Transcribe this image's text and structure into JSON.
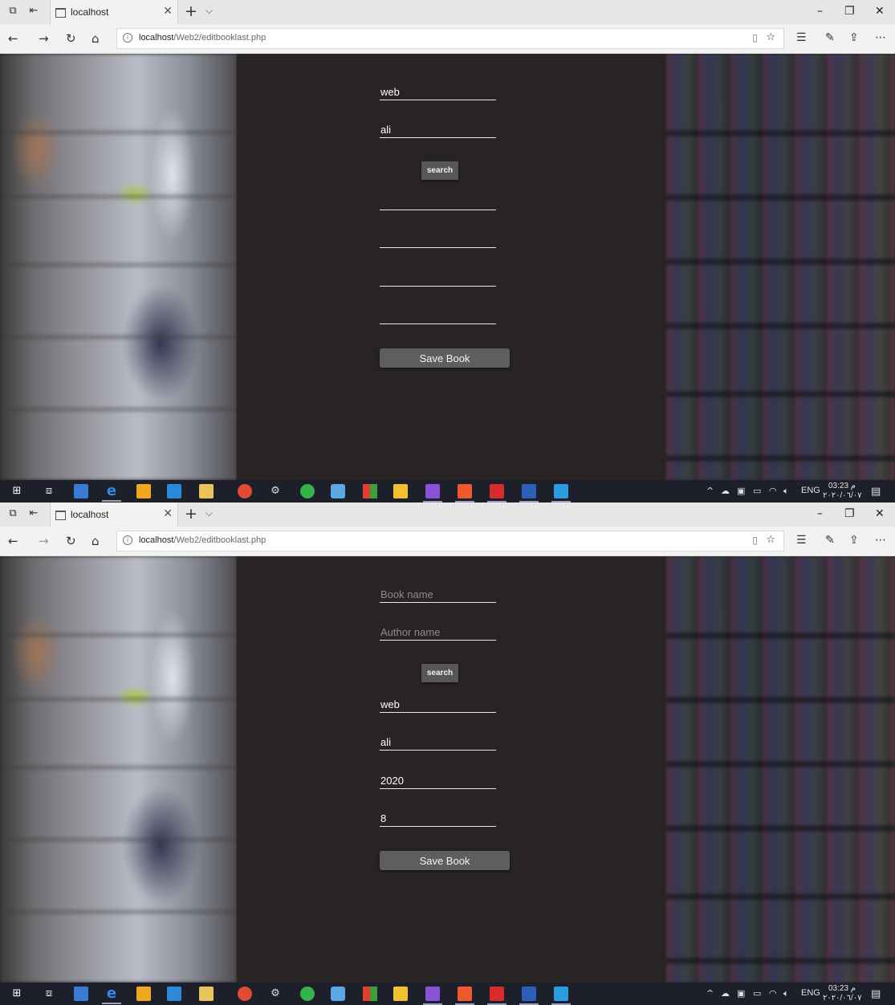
{
  "screens": [
    {
      "browser": {
        "tab_title": "localhost",
        "url_host": "localhost",
        "url_path": "/Web2/editbooklast.php"
      },
      "form": {
        "book_name_value": "web",
        "author_name_value": "ali",
        "search_label": "search",
        "result_name_value": "",
        "result_author_value": "",
        "result_year_value": "",
        "result_count_value": "",
        "save_label": "Save Book"
      },
      "taskbar": {
        "lang": "ENG",
        "time": "03:23 م",
        "date": "٢٠٢٠/٠٦/٠٧"
      }
    },
    {
      "browser": {
        "tab_title": "localhost",
        "url_host": "localhost",
        "url_path": "/Web2/editbooklast.php"
      },
      "form": {
        "book_name_placeholder": "Book name",
        "author_name_placeholder": "Author name",
        "search_label": "search",
        "result_name_value": "web",
        "result_author_value": "ali",
        "result_year_value": "2020",
        "result_count_value": "8",
        "save_label": "Save Book"
      },
      "taskbar": {
        "lang": "ENG",
        "time": "03:23 م",
        "date": "٢٠٢٠/٠٦/٠٧"
      }
    }
  ],
  "icons": {
    "tab_actions": "tab-actions-icon",
    "set_aside": "set-aside-tabs-icon",
    "page": "page-icon",
    "back": "back-arrow-icon",
    "forward": "forward-arrow-icon",
    "refresh": "refresh-icon",
    "home": "home-icon",
    "reading_view": "reading-view-icon",
    "favorite": "star-icon"
  },
  "colors": {
    "page_background": "#282423",
    "field_text": "#ffffff",
    "field_underline": "#e9e9e9",
    "button_background": "#575757",
    "taskbar": "#1d1f2b"
  }
}
